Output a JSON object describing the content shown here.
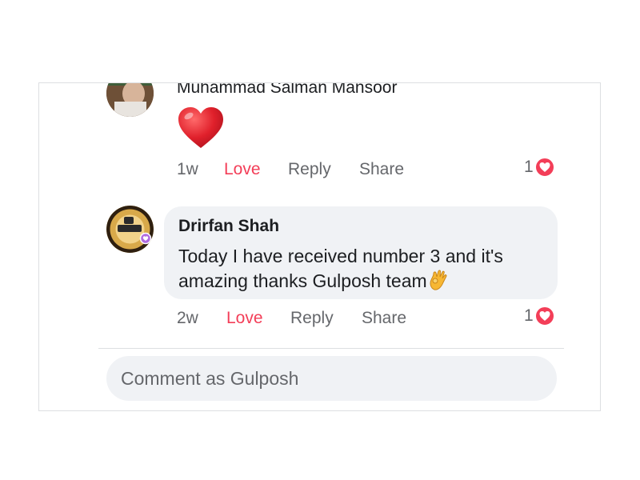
{
  "comments": [
    {
      "author": "Muhammad Salman Mansoor",
      "content_emoji": "red-heart",
      "time": "1w",
      "love_label": "Love",
      "reply_label": "Reply",
      "share_label": "Share",
      "reaction_count": "1"
    },
    {
      "author": "Drirfan Shah",
      "text": "Today I have received number 3 and it's amazing thanks Gulposh team",
      "text_emoji": "ok-hand",
      "time": "2w",
      "love_label": "Love",
      "reply_label": "Reply",
      "share_label": "Share",
      "reaction_count": "1"
    }
  ],
  "composer": {
    "placeholder": "Comment as Gulposh"
  },
  "colors": {
    "love": "#f33e58",
    "bubble": "#f0f2f5",
    "muted_text": "#65676b"
  }
}
